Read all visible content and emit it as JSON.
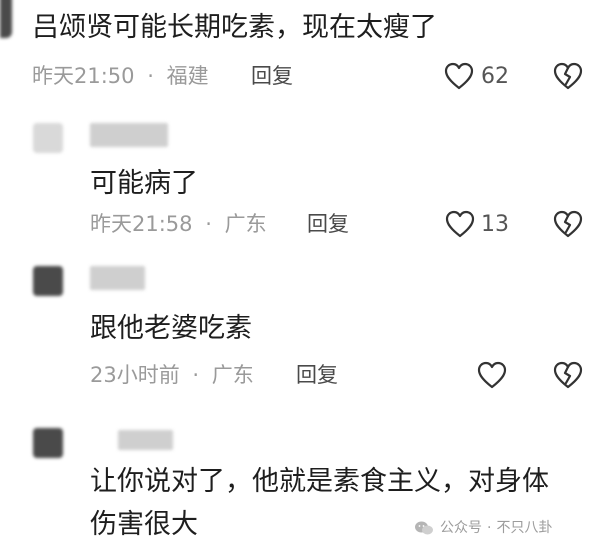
{
  "comments": [
    {
      "text": "吕颂贤可能长期吃素，现在太瘦了",
      "time": "昨天21:50",
      "location": "福建",
      "reply": "回复",
      "likes": "62"
    },
    {
      "text": "可能病了",
      "time": "昨天21:58",
      "location": "广东",
      "reply": "回复",
      "likes": "13"
    },
    {
      "text": "跟他老婆吃素",
      "time": "23小时前",
      "location": "广东",
      "reply": "回复",
      "likes": ""
    },
    {
      "text_line1": "让你说对了，他就是素食主义，对身体",
      "text_line2": "伤害很大"
    }
  ],
  "separator": "·",
  "watermark": {
    "source": "公众号",
    "account": "不只八卦"
  },
  "icons": [
    "heart-icon",
    "broken-heart-icon",
    "wechat-icon"
  ]
}
